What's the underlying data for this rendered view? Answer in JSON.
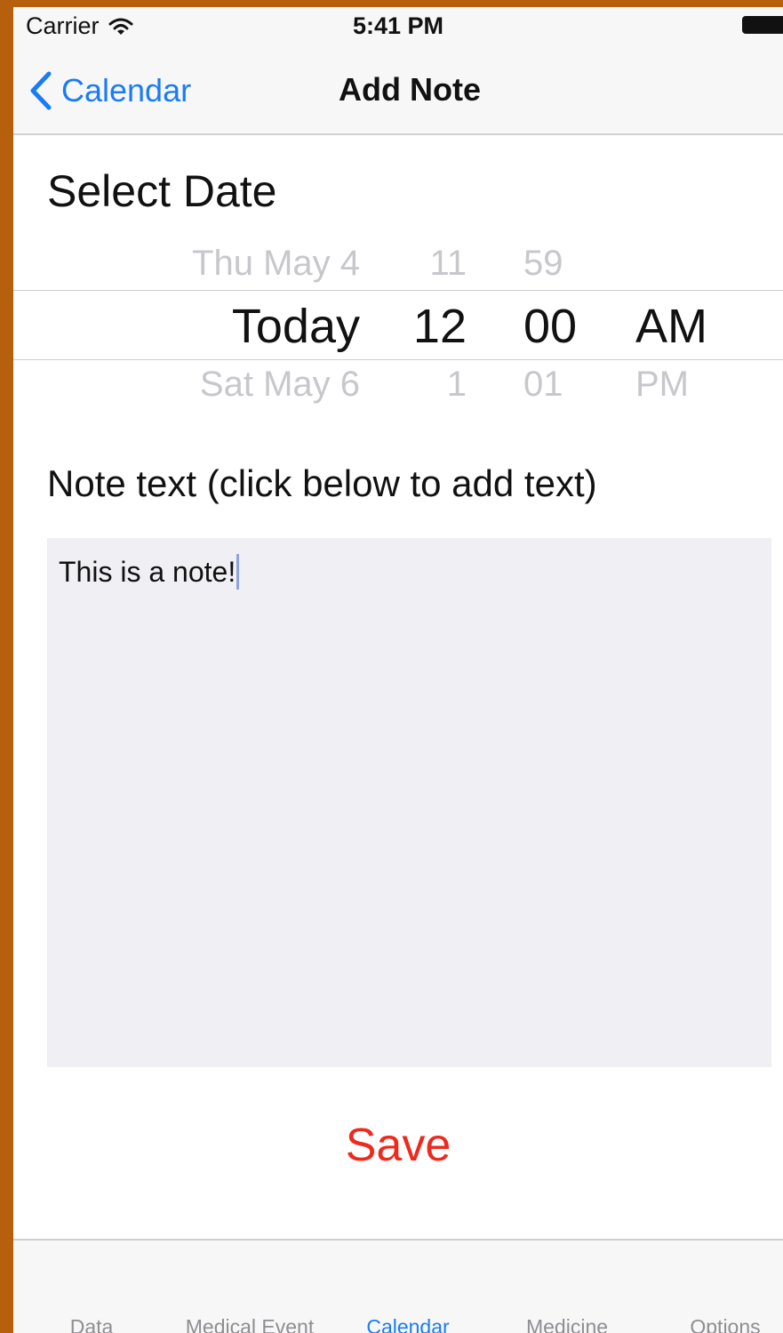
{
  "status_bar": {
    "carrier": "Carrier",
    "time": "5:41 PM",
    "wifi_icon": "wifi-icon",
    "battery_icon": "battery-icon"
  },
  "nav": {
    "back_label": "Calendar",
    "title": "Add Note"
  },
  "date_section": {
    "label": "Select Date"
  },
  "picker": {
    "date": {
      "above": "Thu May 4",
      "selected": "Today",
      "below": "Sat May 6"
    },
    "hour": {
      "above": "11",
      "selected": "12",
      "below": "1"
    },
    "minute": {
      "above": "59",
      "selected": "00",
      "below": "01"
    },
    "ampm": {
      "selected": "AM",
      "below": "PM"
    }
  },
  "note": {
    "label": "Note text (click below to add text)",
    "value": "This is a note!"
  },
  "save_label": "Save",
  "tabs": [
    {
      "label": "Data",
      "active": false
    },
    {
      "label": "Medical Event",
      "active": false
    },
    {
      "label": "Calendar",
      "active": true
    },
    {
      "label": "Medicine",
      "active": false
    },
    {
      "label": "Options",
      "active": false
    }
  ],
  "colors": {
    "accent": "#1a7cf5",
    "save": "#ee2a1e",
    "frame": "#b65f0c",
    "note_background": "#efeff4"
  }
}
